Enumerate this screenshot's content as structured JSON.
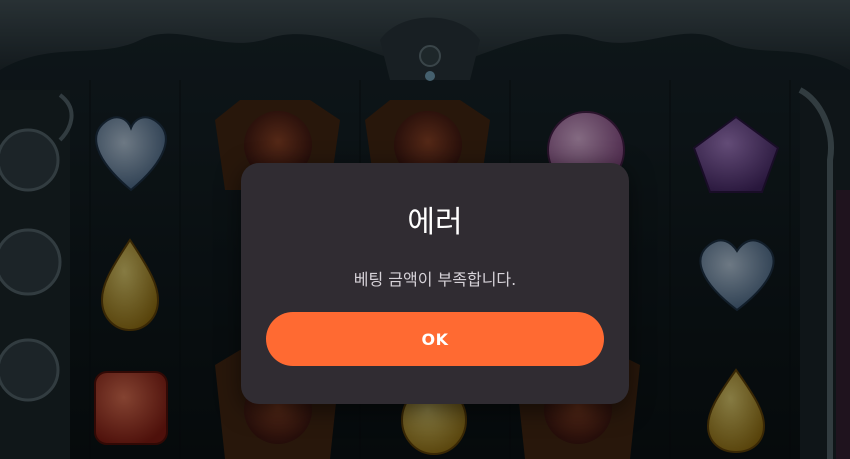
{
  "dialog": {
    "title": "에러",
    "message": "베팅 금액이 부족합니다.",
    "ok_label": "OK"
  },
  "colors": {
    "dialog_background": "#302c32",
    "button": "#ff6a32",
    "scene_background": "#0c1418"
  },
  "scene": {
    "gems": [
      "blue-heart-gem",
      "purple-pentagon-gem",
      "pink-round-gem",
      "yellow-drop-gem",
      "blue-heart-gem",
      "red-square-gem",
      "yellow-drop-gem",
      "yellow-round-gem",
      "vampire-character",
      "vampire-character",
      "vampire-character",
      "vampire-character"
    ]
  }
}
